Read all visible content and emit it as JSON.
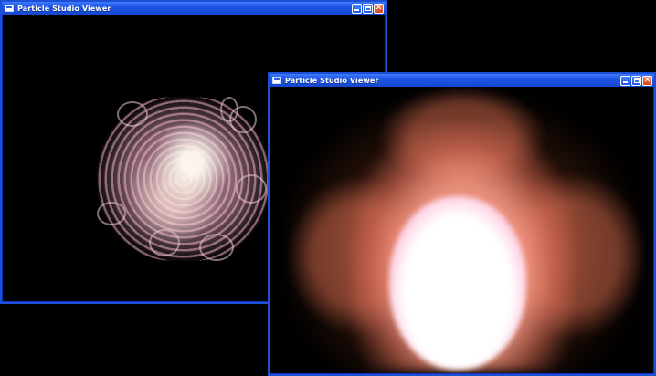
{
  "windows": [
    {
      "title": "Particle Studio Viewer",
      "controls": {
        "minimize": "minimize-icon",
        "maximize": "maximize-icon",
        "close": "close-icon"
      }
    },
    {
      "title": "Particle Studio Viewer",
      "controls": {
        "minimize": "minimize-icon",
        "maximize": "maximize-icon",
        "close": "close-icon"
      }
    }
  ],
  "colors": {
    "titlebar": "#1f58e6",
    "close_button": "#d4431c",
    "viewport_background": "#000000",
    "particle_warm": "#e07a5a",
    "particle_core": "#ffffff"
  }
}
